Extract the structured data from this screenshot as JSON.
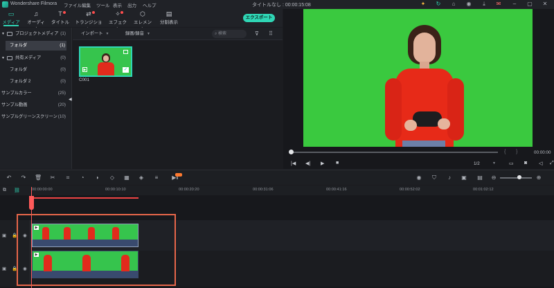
{
  "titlebar": {
    "app_name": "Wondershare Filmora",
    "menu": [
      "ファイル",
      "編集",
      "ツール",
      "表示",
      "出力",
      "ヘルプ"
    ],
    "doc_title": "タイトルなし : 00:00:15:08"
  },
  "toolbar": {
    "tabs": [
      {
        "label": "メディア",
        "icon": "folder-icon"
      },
      {
        "label": "オーディオ",
        "icon": "music-note-icon"
      },
      {
        "label": "タイトル",
        "icon": "text-icon"
      },
      {
        "label": "トランジション",
        "icon": "transition-icon"
      },
      {
        "label": "エフェクト",
        "icon": "effects-icon"
      },
      {
        "label": "エレメント",
        "icon": "elements-icon"
      },
      {
        "label": "分割表示",
        "icon": "split-screen-icon"
      }
    ],
    "export_label": "エクスポート"
  },
  "left_panel": {
    "items": [
      {
        "label": "プロジェクトメディア",
        "count": "(1)"
      },
      {
        "label": "フォルダ",
        "count": "(1)"
      },
      {
        "label": "共有メディア",
        "count": "(0)"
      },
      {
        "label": "フォルダ",
        "count": "(0)"
      },
      {
        "label": "フォルダ 2",
        "count": "(0)"
      },
      {
        "label": "サンプルカラー",
        "count": "(25)"
      },
      {
        "label": "サンプル動画",
        "count": "(20)"
      },
      {
        "label": "サンプルグリーンスクリーン",
        "count": "(10)"
      }
    ]
  },
  "media": {
    "import_label": "インポート",
    "record_label": "録画/録音",
    "search_placeholder": "検索",
    "clip_name": "C001"
  },
  "preview": {
    "timecode": "00:00:00",
    "zoom_ratio": "1/2"
  },
  "timeline": {
    "ruler": [
      "00:00:00:00",
      "00:00:10:10",
      "00:00:20:20",
      "00:00:31:06",
      "00:00:41:16",
      "00:00:52:02",
      "00:01:02:12"
    ]
  },
  "colors": {
    "accent": "#2fd6b5",
    "green_screen": "#3ac93f",
    "playhead": "#ff5a5a",
    "selection": "#e8664a"
  }
}
